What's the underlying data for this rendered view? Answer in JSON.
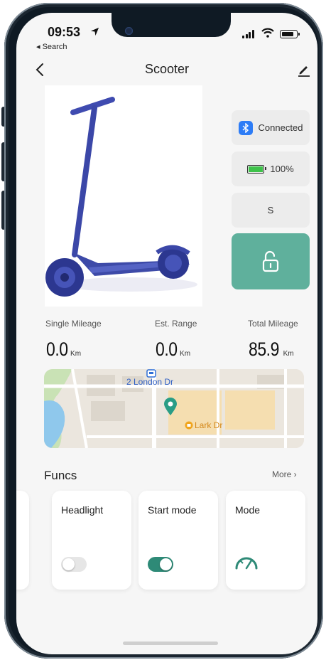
{
  "status_bar": {
    "time": "09:53",
    "back_app": "◂ Search"
  },
  "header": {
    "title": "Scooter"
  },
  "device": {
    "connection_label": "Connected",
    "battery_label": "100%",
    "battery_level_percent": 100,
    "mode_label": "S"
  },
  "stats": {
    "single_mileage": {
      "label": "Single Mileage",
      "value": "0.0",
      "unit": "Km"
    },
    "est_range": {
      "label": "Est. Range",
      "value": "0.0",
      "unit": "Km"
    },
    "total_mileage": {
      "label": "Total Mileage",
      "value": "85.9",
      "unit": "Km"
    }
  },
  "map": {
    "street_label": "2 London Dr",
    "place_label": "Lark Dr"
  },
  "funcs": {
    "title": "Funcs",
    "more_label": "More ›",
    "cards": [
      {
        "title": "Headlight",
        "control": "toggle",
        "on": false
      },
      {
        "title": "Start mode",
        "control": "toggle",
        "on": true
      },
      {
        "title": "Mode",
        "control": "gauge-icon"
      }
    ]
  },
  "colors": {
    "accent": "#5fb09c",
    "toggle_on": "#2e8a77",
    "bluetooth": "#2d7cf6",
    "battery_fill": "#3ec24a"
  }
}
